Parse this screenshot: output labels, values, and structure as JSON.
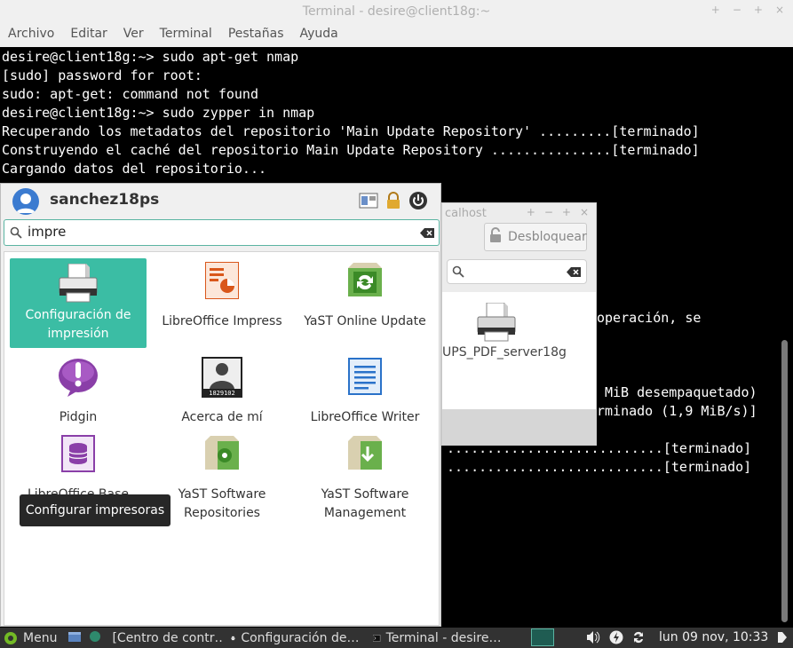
{
  "terminal": {
    "title": "Terminal - desire@client18g:~",
    "menu": [
      "Archivo",
      "Editar",
      "Ver",
      "Terminal",
      "Pestañas",
      "Ayuda"
    ],
    "lines": [
      "desire@client18g:~> sudo apt-get nmap",
      "[sudo] password for root:",
      "sudo: apt-get: command not found",
      "desire@client18g:~> sudo zypper in nmap",
      "Recuperando los metadatos del repositorio 'Main Update Repository' .........[terminado]",
      "Construyendo el caché del repositorio Main Update Repository ...............[terminado]",
      "Cargando datos del repositorio..."
    ],
    "partial_lines": [
      "operación, se",
      "MiB desempaquetado)",
      "rminado (1,9 MiB/s)]",
      "...........................[terminado]",
      "...........................[terminado]"
    ]
  },
  "dialog": {
    "title": "calhost",
    "unlock_label": "Desbloquear",
    "printer_label": "UPS_PDF_server18g"
  },
  "menu": {
    "username": "sanchez18ps",
    "search_value": "impre",
    "results": [
      {
        "label": "Configuración de impresión",
        "icon": "printer-icon"
      },
      {
        "label": "LibreOffice Impress",
        "icon": "libreoffice-impress-icon"
      },
      {
        "label": "YaST Online Update",
        "icon": "yast-online-update-icon"
      },
      {
        "label": "Pidgin",
        "icon": "pidgin-icon"
      },
      {
        "label": "Acerca de mí",
        "icon": "about-me-icon"
      },
      {
        "label": "LibreOffice Writer",
        "icon": "libreoffice-writer-icon"
      },
      {
        "label": "LibreOffice Base",
        "icon": "libreoffice-base-icon"
      },
      {
        "label": "YaST Software Repositories",
        "icon": "yast-software-repositories-icon"
      },
      {
        "label": "YaST Software Management",
        "icon": "yast-software-management-icon"
      }
    ],
    "about_me_badge": "1829102",
    "tooltip": "Configurar impresoras"
  },
  "taskbar": {
    "menu_label": "Menu",
    "items": [
      "[Centro de contr…",
      "Configuración de…",
      "Terminal - desire…"
    ],
    "clock": "lun 09 nov, 10:33"
  },
  "colors": {
    "accent": "#3bbda4",
    "terminal_bg": "#000000",
    "taskbar_bg": "#323232"
  }
}
